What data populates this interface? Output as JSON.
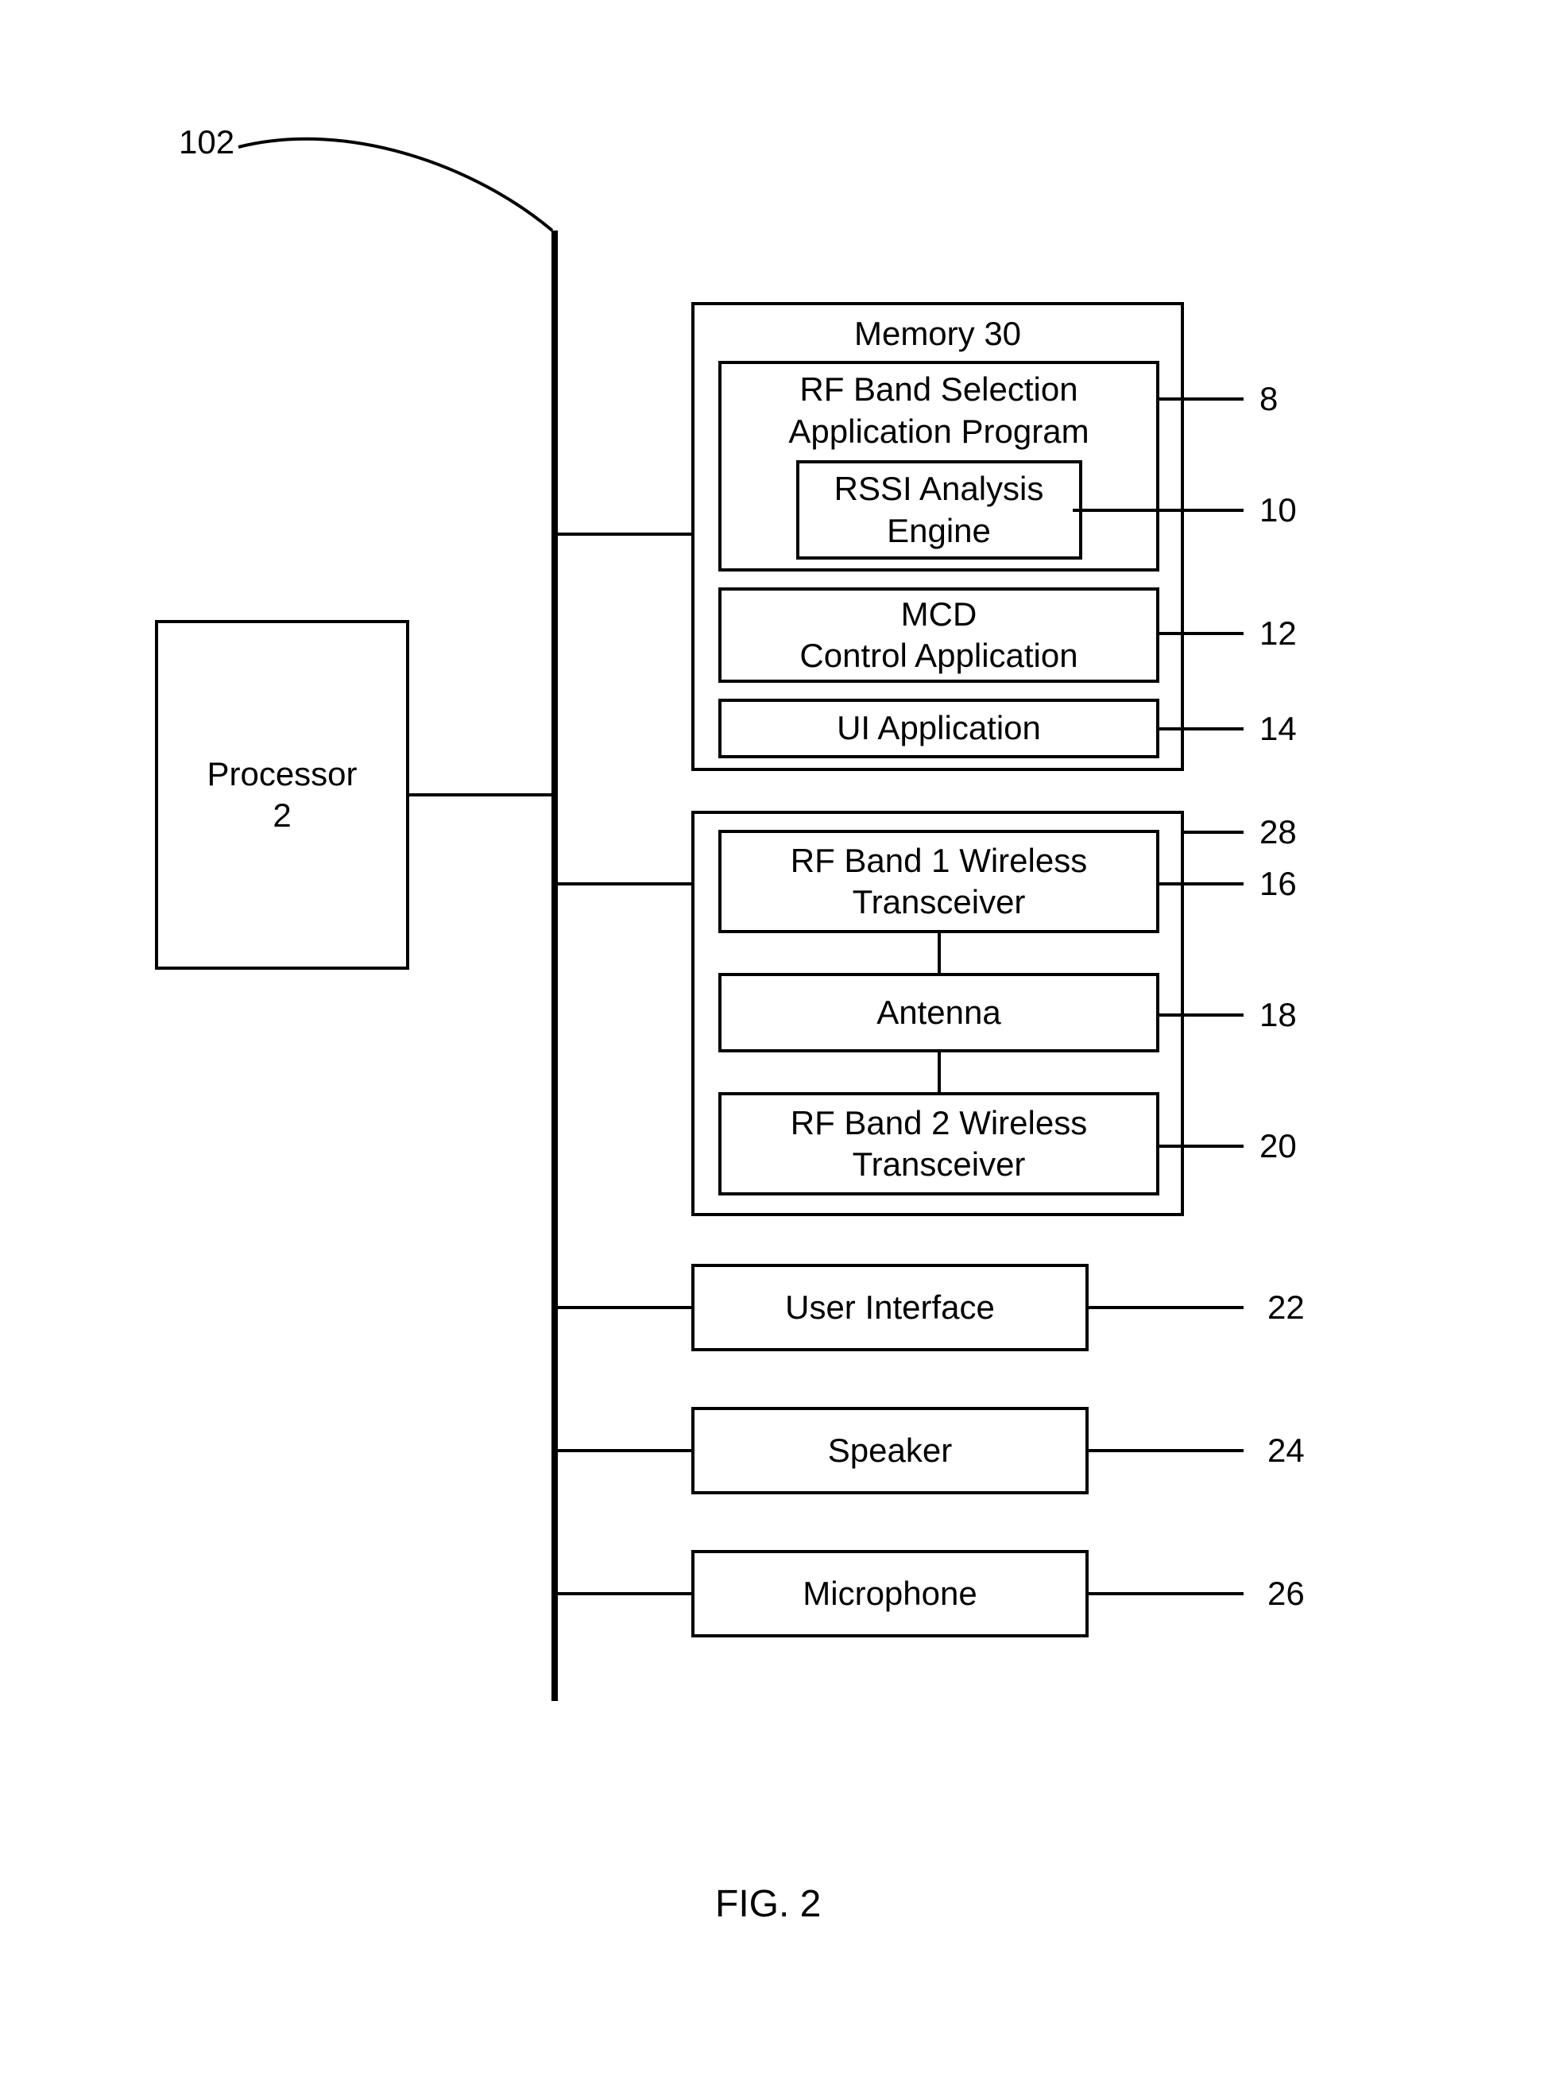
{
  "refnum": {
    "system": "102",
    "processor": "2",
    "rf_sel": "8",
    "rssi": "10",
    "mcd": "12",
    "ui_app": "14",
    "memory": "30",
    "rf1": "16",
    "antenna": "18",
    "rf2": "20",
    "user_if": "22",
    "speaker": "24",
    "microphone": "26",
    "wireless_block": "28"
  },
  "labels": {
    "processor_l1": "Processor",
    "processor_l2": "2",
    "memory_title": "Memory 30",
    "rf_sel_l1": "RF Band Selection",
    "rf_sel_l2": "Application Program",
    "rssi_l1": "RSSI Analysis",
    "rssi_l2": "Engine",
    "mcd_l1": "MCD",
    "mcd_l2": "Control Application",
    "ui_app": "UI Application",
    "rf1_l1": "RF Band 1 Wireless",
    "rf1_l2": "Transceiver",
    "antenna": "Antenna",
    "rf2_l1": "RF Band 2 Wireless",
    "rf2_l2": "Transceiver",
    "user_if": "User Interface",
    "speaker": "Speaker",
    "microphone": "Microphone",
    "figure": "FIG. 2"
  }
}
